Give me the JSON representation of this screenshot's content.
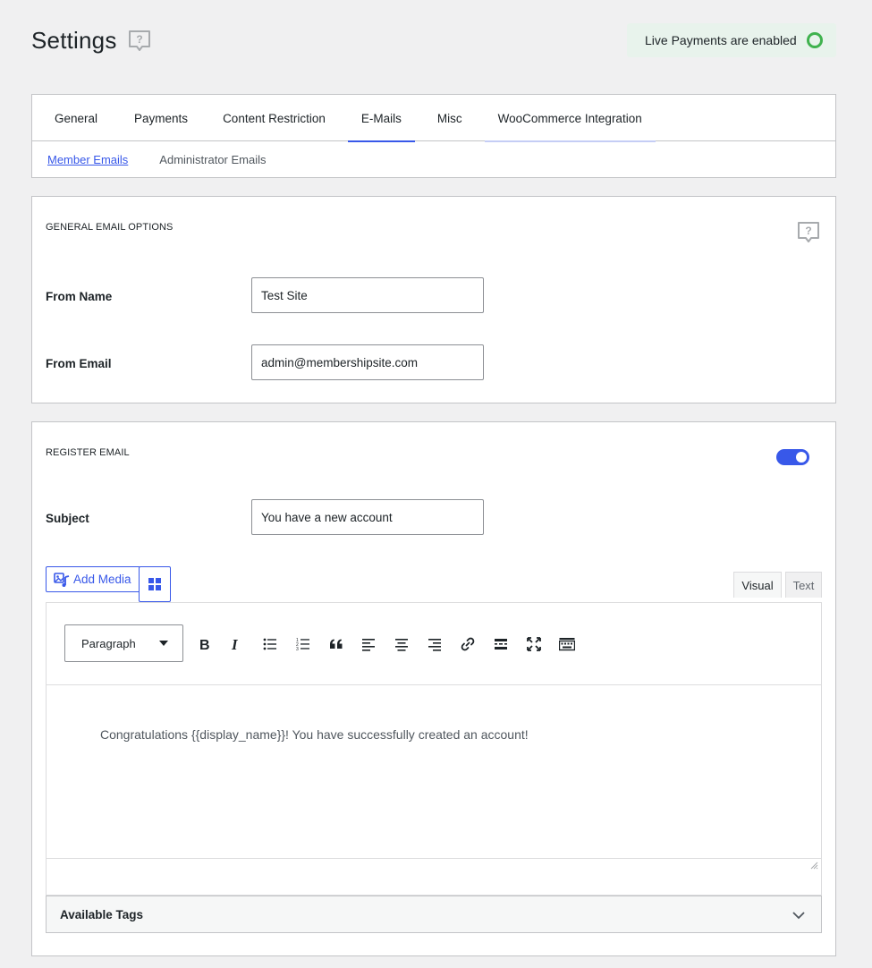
{
  "page": {
    "title": "Settings"
  },
  "status": {
    "live_text": "Live Payments are enabled",
    "live_color": "#3fb24e"
  },
  "tabs": [
    {
      "label": "General"
    },
    {
      "label": "Payments"
    },
    {
      "label": "Content Restriction"
    },
    {
      "label": "E-Mails",
      "active": true
    },
    {
      "label": "Misc"
    },
    {
      "label": "WooCommerce Integration"
    }
  ],
  "subtabs": [
    {
      "label": "Member Emails",
      "active": true
    },
    {
      "label": "Administrator Emails"
    }
  ],
  "general_options": {
    "title": "GENERAL EMAIL OPTIONS",
    "from_name_label": "From Name",
    "from_name_value": "Test Site",
    "from_email_label": "From Email",
    "from_email_value": "admin@membershipsite.com"
  },
  "register_email": {
    "title": "REGISTER EMAIL",
    "enabled": true,
    "subject_label": "Subject",
    "subject_value": "You have a new account",
    "add_media_label": "Add Media",
    "mode_visual": "Visual",
    "mode_text": "Text",
    "format_value": "Paragraph",
    "body": "Congratulations {{display_name}}! You have successfully created an account!",
    "available_tags_label": "Available Tags"
  },
  "colors": {
    "accent": "#3858e9",
    "border": "#c3c4c7",
    "background": "#f0f0f1"
  },
  "icons": [
    "help-icon",
    "add-media-icon",
    "blocks-icon",
    "bold-icon",
    "italic-icon",
    "bullet-list-icon",
    "numbered-list-icon",
    "blockquote-icon",
    "align-left-icon",
    "align-center-icon",
    "align-right-icon",
    "link-icon",
    "read-more-icon",
    "fullscreen-icon",
    "toolbar-toggle-icon",
    "chevron-down-icon"
  ]
}
